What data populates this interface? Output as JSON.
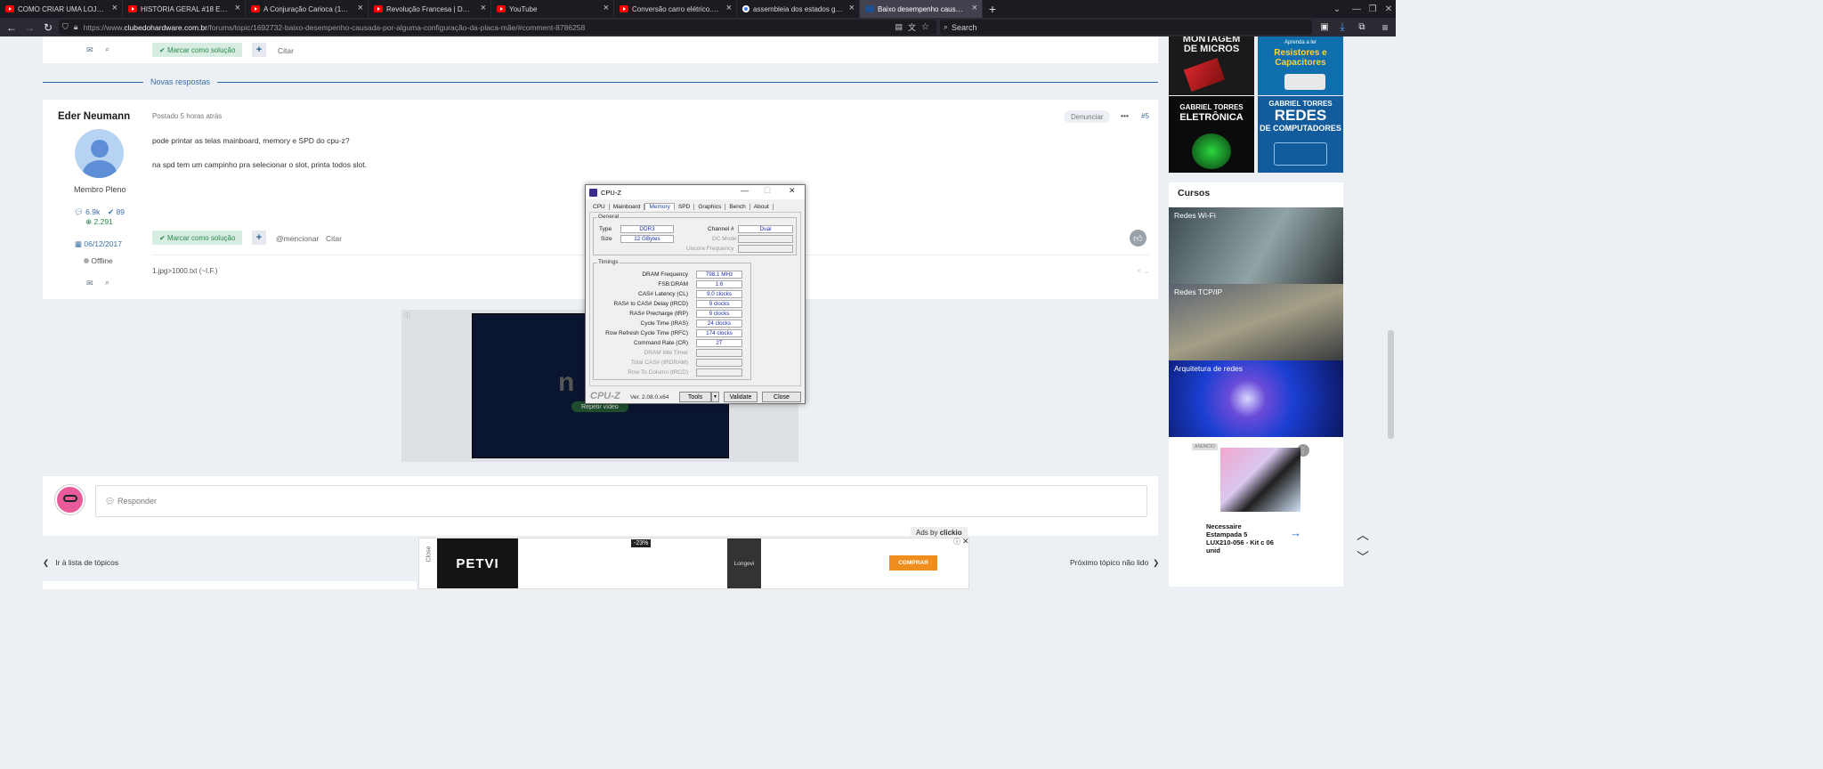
{
  "browser": {
    "tabs": [
      {
        "title": "COMO CRIAR UMA LOJA DE DI",
        "icon": "youtube-icon"
      },
      {
        "title": "HISTÓRIA GERAL #18 ERA NA",
        "icon": "youtube-icon"
      },
      {
        "title": "A Conjuração Carioca (1794)",
        "icon": "youtube-icon"
      },
      {
        "title": "Revolução Francesa | DEIXA O",
        "icon": "youtube-icon"
      },
      {
        "title": "YouTube",
        "icon": "youtube-icon"
      },
      {
        "title": "Conversão carro elétrico. - You",
        "icon": "youtube-icon"
      },
      {
        "title": "assembleia dos estados gerais",
        "icon": "google-icon"
      },
      {
        "title": "Baixo desempenho causada po",
        "icon": "clube-do-hardware-icon",
        "active": true
      }
    ],
    "new_tab": "+",
    "url": {
      "prefix": "https://www.",
      "host": "clubedohardware.com.br",
      "path": "/forums/topic/1692732-baixo-desempenho-causada-por-alguma-configuração-da-placa-mãe/#comment-8786258"
    },
    "search_placeholder": "Search"
  },
  "prev_post": {
    "solution_label": "Marcar como solução",
    "quote_label": "Citar"
  },
  "divider_label": "Novas respostas",
  "post": {
    "author": "Eder Neumann",
    "posted": "Postado 5 horas atrás",
    "report": "Denunciar",
    "more": "•••",
    "number": "#5",
    "lines": [
      "pode printar as telas mainboard,  memory e SPD do cpu-z?",
      "na spd tem um campinho pra selecionar o slot, printa todos slot."
    ],
    "rank": "Membro Pleno",
    "posts_count": "6.9k",
    "solutions_count": "89",
    "reputation": "2.291",
    "joined": "06/12/2017",
    "status": "Offline",
    "solution_label": "Marcar como solução",
    "mention_label": "@mencionar",
    "quote_label": "Citar",
    "signature": "1.jpg>1000.txt (~I.F.)"
  },
  "video": {
    "repeat_label": "Repetir vídeo",
    "letter": "n"
  },
  "cpuz": {
    "title": "CPU-Z",
    "tabs": [
      "CPU",
      "Mainboard",
      "Memory",
      "SPD",
      "Graphics",
      "Bench",
      "About"
    ],
    "active_tab": "Memory",
    "general_label": "General",
    "general": {
      "type_label": "Type",
      "type": "DDR3",
      "size_label": "Size",
      "size": "12 GBytes",
      "channel_label": "Channel #",
      "channel": "Dual",
      "dc_mode_label": "DC Mode",
      "uncore_label": "Uncore Frequency"
    },
    "timings_label": "Timings",
    "timings": [
      {
        "label": "DRAM Frequency",
        "value": "798.1 MHz"
      },
      {
        "label": "FSB:DRAM",
        "value": "1:6"
      },
      {
        "label": "CAS# Latency (CL)",
        "value": "9.0 clocks"
      },
      {
        "label": "RAS# to CAS# Delay (tRCD)",
        "value": "9 clocks"
      },
      {
        "label": "RAS# Precharge (tRP)",
        "value": "9 clocks"
      },
      {
        "label": "Cycle Time (tRAS)",
        "value": "24 clocks"
      },
      {
        "label": "Row Refresh Cycle Time (tRFC)",
        "value": "174 clocks"
      },
      {
        "label": "Command Rate (CR)",
        "value": "2T"
      },
      {
        "label": "DRAM Idle Timer",
        "value": "",
        "dim": true
      },
      {
        "label": "Total CAS# (tRDRAM)",
        "value": "",
        "dim": true
      },
      {
        "label": "Row To Column (tRCD)",
        "value": "",
        "dim": true
      }
    ],
    "brand": "CPU-Z",
    "version": "Ver. 2.08.0.x64",
    "tools_label": "Tools",
    "validate_label": "Validate",
    "close_label": "Close"
  },
  "reply": {
    "placeholder": "Responder"
  },
  "ads": {
    "ads_by": "Ads by",
    "ads_brand": "clickio",
    "close_vertical": "Close",
    "brand1": "PETVI",
    "discount": "-23%",
    "product_brand": "Longevi",
    "buy_label": "COMPRAR",
    "anuncio": "ANÚNCIO",
    "product_title": "Necessaire Estampada 5 LUX210-056 - Kit c 06 unid"
  },
  "footer": {
    "back_label": "Ir à lista de tópicos",
    "next_label": "Próximo tópico não lido"
  },
  "sidebar": {
    "books": [
      {
        "lines": [
          "MONTAGEM",
          "DE MICROS"
        ]
      },
      {
        "lines": [
          "Aprenda a ler",
          "Resistores e",
          "Capacitores"
        ]
      },
      {
        "lines": [
          "GABRIEL TORRES",
          "ELETRÔNICA"
        ]
      },
      {
        "lines": [
          "GABRIEL TORRES",
          "REDES",
          "DE COMPUTADORES"
        ]
      }
    ],
    "cursos_title": "Cursos",
    "cursos": [
      "Redes Wi-Fi",
      "Redes TCP/IP",
      "Arquitetura de redes"
    ]
  }
}
